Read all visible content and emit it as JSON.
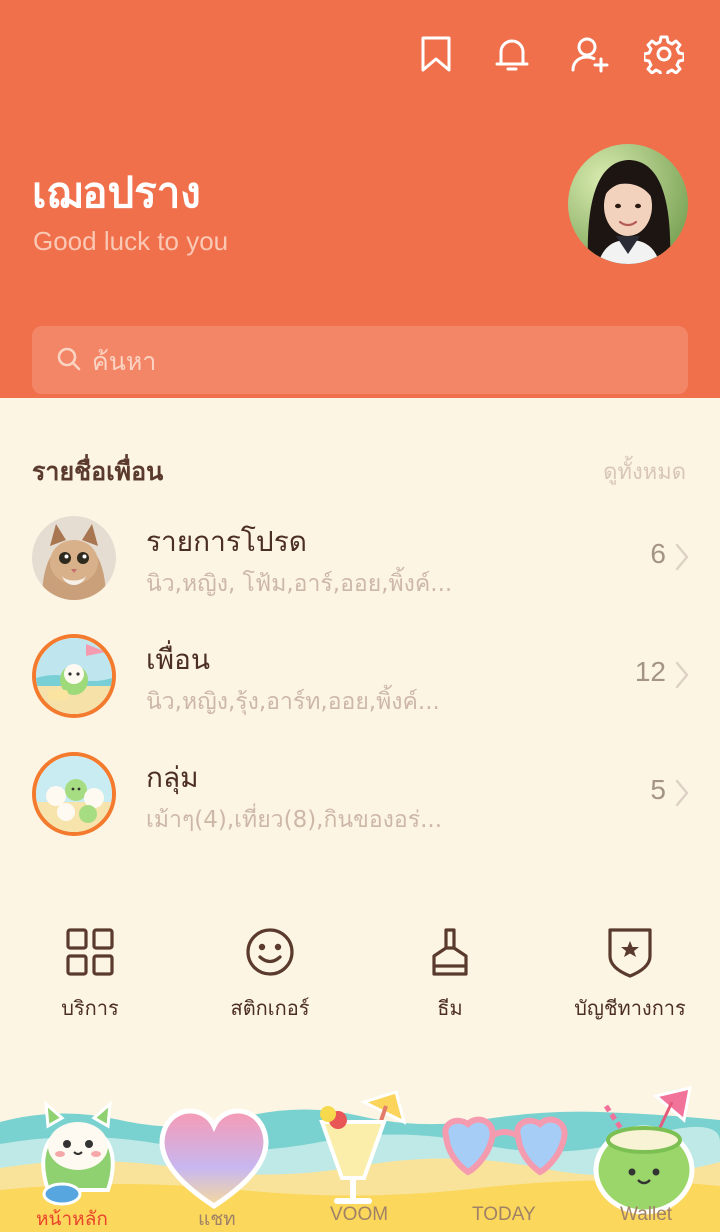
{
  "header": {
    "icons": [
      "bookmark-icon",
      "bell-icon",
      "add-friend-icon",
      "gear-icon"
    ],
    "colors": {
      "bg": "#f0704c",
      "search_bg": "#f38667"
    }
  },
  "profile": {
    "name": "เฌอปราง",
    "status": "Good luck to you"
  },
  "search": {
    "placeholder": "ค้นหา"
  },
  "friends": {
    "title": "รายชื่อเพื่อน",
    "see_all": "ดูทั้งหมด",
    "rows": [
      {
        "title": "รายการโปรด",
        "subtitle": "นิว,หญิง, โฟ้ม,อาร์,ออย,พิ้งค์...",
        "count": "6"
      },
      {
        "title": "เพื่อน",
        "subtitle": "นิว,หญิง,รุ้ง,อาร์ท,ออย,พิ้งค์...",
        "count": "12"
      },
      {
        "title": "กลุ่ม",
        "subtitle": "เม้าๆ(4),เที่ยว(8),กินของอร่...",
        "count": "5"
      }
    ]
  },
  "services": [
    {
      "label": "บริการ",
      "icon": "grid-icon"
    },
    {
      "label": "สติกเกอร์",
      "icon": "smiley-icon"
    },
    {
      "label": "ธีม",
      "icon": "brush-icon"
    },
    {
      "label": "บัญชีทางการ",
      "icon": "shield-star-icon"
    }
  ],
  "tabbar": {
    "tabs": [
      {
        "label": "หน้าหลัก",
        "active": true
      },
      {
        "label": "แชท",
        "active": false
      },
      {
        "label": "VOOM",
        "active": false
      },
      {
        "label": "TODAY",
        "active": false
      },
      {
        "label": "Wallet",
        "active": false
      }
    ],
    "colors": {
      "active": "#e8452c",
      "inactive": "#a08266",
      "sand": "#fbd96a",
      "sea": "#7fd6d4"
    }
  }
}
